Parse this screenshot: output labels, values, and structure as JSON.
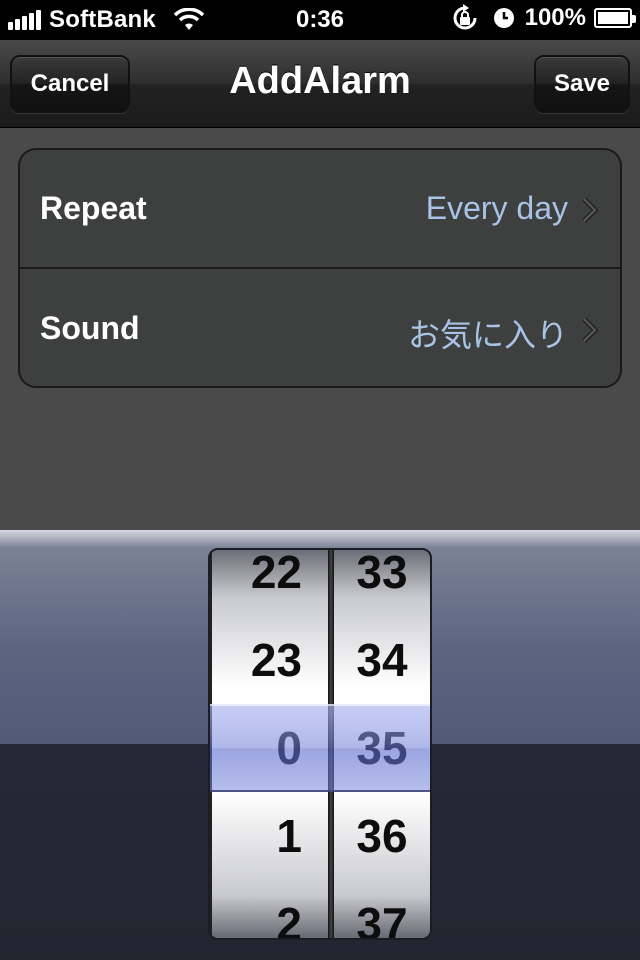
{
  "status_bar": {
    "carrier": "SoftBank",
    "time": "0:36",
    "battery": "100%",
    "icons": [
      "signal-icon",
      "wifi-icon",
      "rotation-lock-icon",
      "alarm-icon",
      "battery-icon"
    ]
  },
  "nav": {
    "title": "AddAlarm",
    "cancel_label": "Cancel",
    "save_label": "Save"
  },
  "settings": [
    {
      "label": "Repeat",
      "value": "Every day"
    },
    {
      "label": "Sound",
      "value": "お気に入り"
    }
  ],
  "picker": {
    "hours": [
      "22",
      "23",
      "0",
      "1",
      "2"
    ],
    "minutes": [
      "33",
      "34",
      "35",
      "36",
      "37"
    ],
    "selected_hour": "0",
    "selected_minute": "35"
  },
  "colors": {
    "value_text": "#a9c3e6",
    "selection_bar": "#7b87d8"
  }
}
